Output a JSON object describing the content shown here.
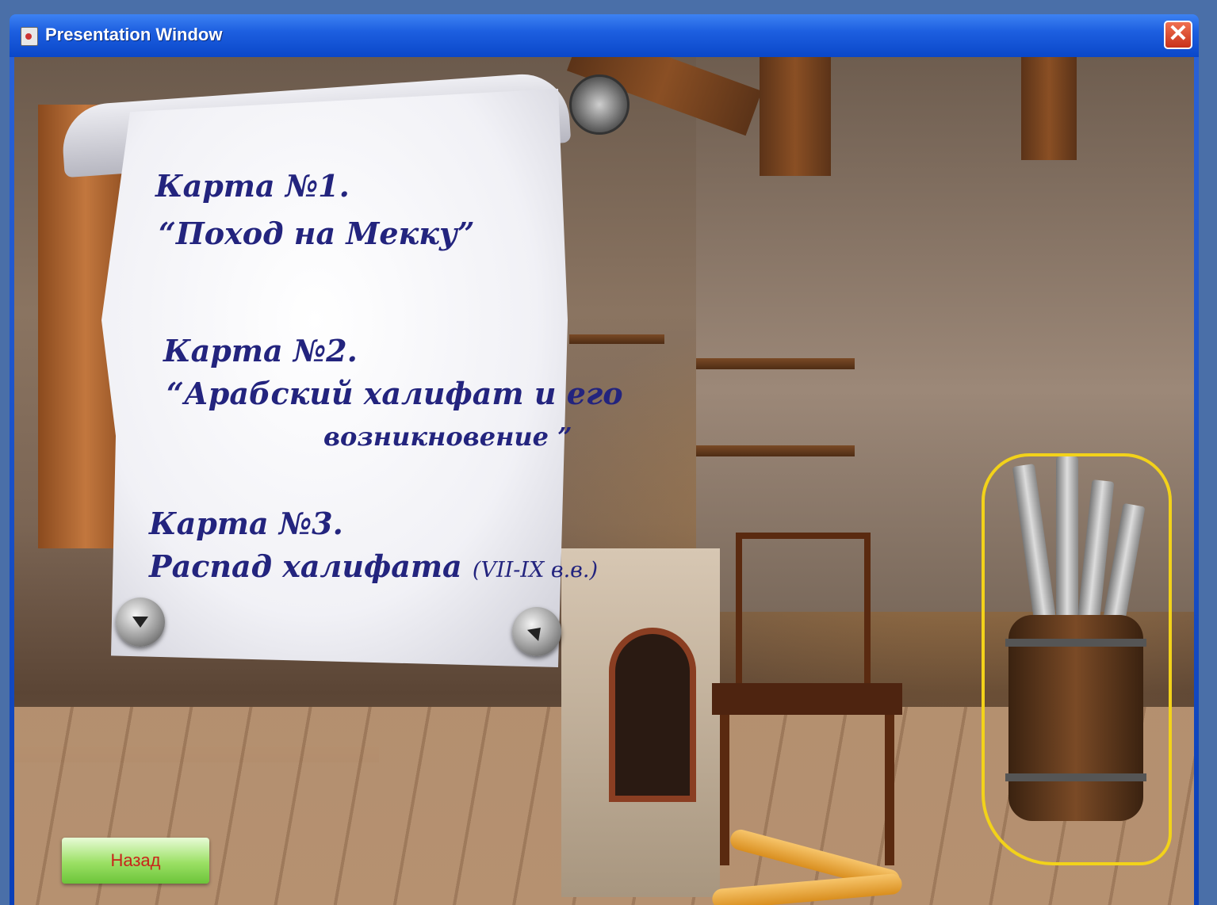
{
  "window": {
    "title": "Presentation Window",
    "close_label": "✕"
  },
  "scroll": {
    "maps": [
      {
        "number": "Карта №1.",
        "title": "“Поход на Мекку”"
      },
      {
        "number": "Карта №2.",
        "title_line1": "“Арабский халифат и его",
        "title_line2": "возникновение ”"
      },
      {
        "number": "Карта №3.",
        "title": "Распад халифата",
        "period": "(VII-IX в.в.)"
      }
    ]
  },
  "navigation": {
    "prev_icon": "triangle-down-icon",
    "next_icon": "triangle-up-left-icon"
  },
  "back_button": {
    "label": "Назад"
  },
  "colors": {
    "title_bar": "#1d5fe0",
    "scroll_text": "#23247e",
    "back_button": "#9be064",
    "back_button_text": "#c8241b",
    "highlight_outline": "#f2d21a"
  }
}
